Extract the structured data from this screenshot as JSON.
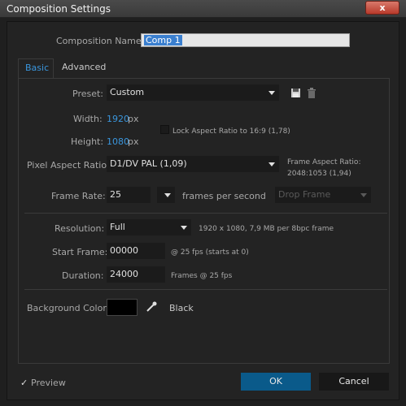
{
  "window": {
    "title": "Composition Settings",
    "close_symbol": "x"
  },
  "comp_name": {
    "label": "Composition Name:",
    "value": "Comp 1"
  },
  "tabs": [
    {
      "label": "Basic"
    },
    {
      "label": "Advanced"
    }
  ],
  "preset": {
    "label": "Preset:",
    "value": "Custom"
  },
  "width": {
    "label": "Width:",
    "value": "1920",
    "unit": "px"
  },
  "height": {
    "label": "Height:",
    "value": "1080",
    "unit": "px"
  },
  "lock_aspect": {
    "label": "Lock Aspect Ratio to 16:9 (1,78)",
    "checked": false
  },
  "pixel_aspect": {
    "label": "Pixel Aspect Ratio:",
    "value": "D1/DV PAL (1,09)"
  },
  "frame_aspect": {
    "label": "Frame Aspect Ratio:",
    "value": "2048:1053 (1,94)"
  },
  "frame_rate": {
    "label": "Frame Rate:",
    "value": "25",
    "unit": "frames per second",
    "drop_frame": "Drop Frame"
  },
  "resolution": {
    "label": "Resolution:",
    "value": "Full",
    "info": "1920 x 1080, 7,9 MB per 8bpc frame"
  },
  "start_frame": {
    "label": "Start Frame:",
    "value": "00000",
    "info": "@ 25 fps (starts at 0)"
  },
  "duration": {
    "label": "Duration:",
    "value": "24000",
    "info": "Frames @ 25 fps"
  },
  "background": {
    "label": "Background Color:",
    "color": "#000000",
    "name": "Black"
  },
  "preview": {
    "label": "Preview",
    "checked": true
  },
  "buttons": {
    "ok": "OK",
    "cancel": "Cancel"
  },
  "colors": {
    "accent_blue": "#3a96dd",
    "ok_button": "#0a5a8a"
  }
}
